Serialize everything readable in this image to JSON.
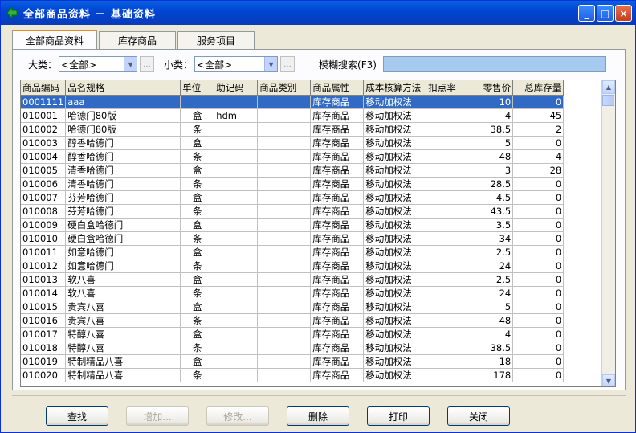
{
  "window": {
    "title": "全部商品资料 － 基础资料",
    "minimize": "_",
    "maximize": "□",
    "close": "×"
  },
  "tabs": [
    "全部商品资料",
    "库存商品",
    "服务项目"
  ],
  "filters": {
    "major_label": "大类：",
    "major_value": "<全部>",
    "minor_label": "小类：",
    "minor_value": "<全部>",
    "dots": "...",
    "search_label": "模糊搜索(F3)",
    "search_value": ""
  },
  "columns": [
    "商品编码",
    "品名规格",
    "单位",
    "助记码",
    "商品类别",
    "商品属性",
    "成本核算方法",
    "扣点率",
    "零售价",
    "总库存量"
  ],
  "rows": [
    [
      "0001111",
      "aaa",
      "",
      "",
      "",
      "库存商品",
      "移动加权法",
      "",
      "10",
      "0"
    ],
    [
      "010001",
      "哈德门80版",
      "盒",
      "hdm",
      "",
      "库存商品",
      "移动加权法",
      "",
      "4",
      "45"
    ],
    [
      "010002",
      "哈德门80版",
      "条",
      "",
      "",
      "库存商品",
      "移动加权法",
      "",
      "38.5",
      "2"
    ],
    [
      "010003",
      "醇香哈德门",
      "盒",
      "",
      "",
      "库存商品",
      "移动加权法",
      "",
      "5",
      "0"
    ],
    [
      "010004",
      "醇香哈德门",
      "条",
      "",
      "",
      "库存商品",
      "移动加权法",
      "",
      "48",
      "4"
    ],
    [
      "010005",
      "清香哈德门",
      "盒",
      "",
      "",
      "库存商品",
      "移动加权法",
      "",
      "3",
      "28"
    ],
    [
      "010006",
      "清香哈德门",
      "条",
      "",
      "",
      "库存商品",
      "移动加权法",
      "",
      "28.5",
      "0"
    ],
    [
      "010007",
      "芬芳哈德门",
      "盒",
      "",
      "",
      "库存商品",
      "移动加权法",
      "",
      "4.5",
      "0"
    ],
    [
      "010008",
      "芬芳哈德门",
      "条",
      "",
      "",
      "库存商品",
      "移动加权法",
      "",
      "43.5",
      "0"
    ],
    [
      "010009",
      "硬白盒哈德门",
      "盒",
      "",
      "",
      "库存商品",
      "移动加权法",
      "",
      "3.5",
      "0"
    ],
    [
      "010010",
      "硬白盒哈德门",
      "条",
      "",
      "",
      "库存商品",
      "移动加权法",
      "",
      "34",
      "0"
    ],
    [
      "010011",
      "如意哈德门",
      "盒",
      "",
      "",
      "库存商品",
      "移动加权法",
      "",
      "2.5",
      "0"
    ],
    [
      "010012",
      "如意哈德门",
      "条",
      "",
      "",
      "库存商品",
      "移动加权法",
      "",
      "24",
      "0"
    ],
    [
      "010013",
      "软八喜",
      "盒",
      "",
      "",
      "库存商品",
      "移动加权法",
      "",
      "2.5",
      "0"
    ],
    [
      "010014",
      "软八喜",
      "条",
      "",
      "",
      "库存商品",
      "移动加权法",
      "",
      "24",
      "0"
    ],
    [
      "010015",
      "贵宾八喜",
      "盒",
      "",
      "",
      "库存商品",
      "移动加权法",
      "",
      "5",
      "0"
    ],
    [
      "010016",
      "贵宾八喜",
      "条",
      "",
      "",
      "库存商品",
      "移动加权法",
      "",
      "48",
      "0"
    ],
    [
      "010017",
      "特醇八喜",
      "盒",
      "",
      "",
      "库存商品",
      "移动加权法",
      "",
      "4",
      "0"
    ],
    [
      "010018",
      "特醇八喜",
      "条",
      "",
      "",
      "库存商品",
      "移动加权法",
      "",
      "38.5",
      "0"
    ],
    [
      "010019",
      "特制精品八喜",
      "盒",
      "",
      "",
      "库存商品",
      "移动加权法",
      "",
      "18",
      "0"
    ],
    [
      "010020",
      "特制精品八喜",
      "条",
      "",
      "",
      "库存商品",
      "移动加权法",
      "",
      "178",
      "0"
    ]
  ],
  "buttons": {
    "find": "查找",
    "add": "增加...",
    "edit": "修改...",
    "delete": "删除",
    "print": "打印",
    "close": "关闭"
  }
}
